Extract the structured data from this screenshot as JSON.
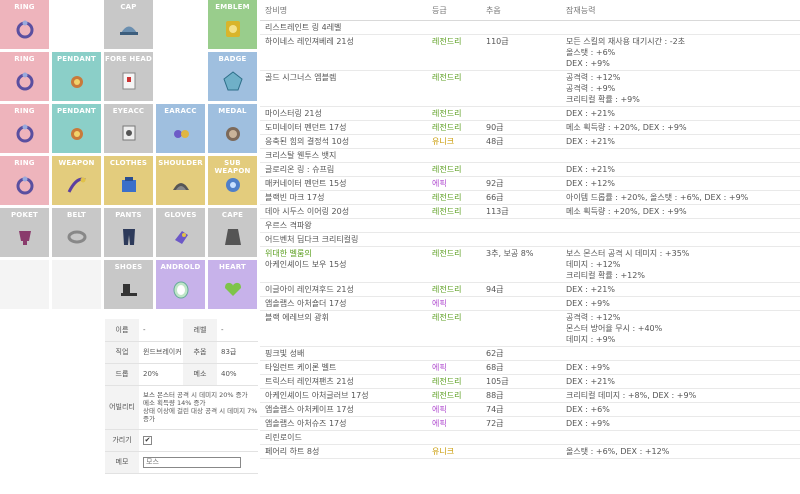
{
  "slots": [
    {
      "key": "ring1",
      "label": "RING",
      "color": "c-pink",
      "icon": "ring-icon",
      "col": 0,
      "row": 0
    },
    {
      "key": "cap",
      "label": "CAP",
      "color": "c-gray",
      "icon": "cap-icon",
      "col": 2,
      "row": 0
    },
    {
      "key": "emblem",
      "label": "EMBLEM",
      "color": "c-green",
      "icon": "emblem-icon",
      "col": 4,
      "row": 0
    },
    {
      "key": "ring2",
      "label": "RING",
      "color": "c-pink",
      "icon": "ring-icon",
      "col": 0,
      "row": 1
    },
    {
      "key": "pendant1",
      "label": "PENDANT",
      "color": "c-teal",
      "icon": "pendant-icon",
      "col": 1,
      "row": 1
    },
    {
      "key": "forehead",
      "label": "FORE HEAD",
      "color": "c-gray",
      "icon": "forehead-icon",
      "col": 2,
      "row": 1
    },
    {
      "key": "badge",
      "label": "BADGE",
      "color": "c-blue",
      "icon": "badge-icon",
      "col": 4,
      "row": 1
    },
    {
      "key": "ring3",
      "label": "RING",
      "color": "c-pink",
      "icon": "ring-icon",
      "col": 0,
      "row": 2
    },
    {
      "key": "pendant2",
      "label": "PENDANT",
      "color": "c-teal",
      "icon": "pendant-icon",
      "col": 1,
      "row": 2
    },
    {
      "key": "eyeacc",
      "label": "EYEACC",
      "color": "c-gray",
      "icon": "eye-accessory-icon",
      "col": 2,
      "row": 2
    },
    {
      "key": "earacc",
      "label": "EARACC",
      "color": "c-blue",
      "icon": "earring-icon",
      "col": 3,
      "row": 2
    },
    {
      "key": "medal",
      "label": "MEDAL",
      "color": "c-blue",
      "icon": "medal-icon",
      "col": 4,
      "row": 2
    },
    {
      "key": "ring4",
      "label": "RING",
      "color": "c-pink",
      "icon": "ring-icon",
      "col": 0,
      "row": 3
    },
    {
      "key": "weapon",
      "label": "WEAPON",
      "color": "c-yellow",
      "icon": "weapon-icon",
      "col": 1,
      "row": 3
    },
    {
      "key": "clothes",
      "label": "CLOTHES",
      "color": "c-yellow",
      "icon": "clothes-icon",
      "col": 2,
      "row": 3
    },
    {
      "key": "shoulder",
      "label": "SHOULDER",
      "color": "c-yellow",
      "icon": "shoulder-icon",
      "col": 3,
      "row": 3
    },
    {
      "key": "subweapon",
      "label": "SUB WEAPON",
      "color": "c-yellow",
      "icon": "sub-weapon-icon",
      "col": 4,
      "row": 3
    },
    {
      "key": "poket",
      "label": "POKET",
      "color": "c-gray",
      "icon": "pocket-icon",
      "col": 0,
      "row": 4
    },
    {
      "key": "belt",
      "label": "BELT",
      "color": "c-gray",
      "icon": "belt-icon",
      "col": 1,
      "row": 4
    },
    {
      "key": "pants",
      "label": "PANTS",
      "color": "c-gray",
      "icon": "pants-icon",
      "col": 2,
      "row": 4
    },
    {
      "key": "gloves",
      "label": "GLOVES",
      "color": "c-gray",
      "icon": "gloves-icon",
      "col": 3,
      "row": 4
    },
    {
      "key": "cape",
      "label": "CAPE",
      "color": "c-gray",
      "icon": "cape-icon",
      "col": 4,
      "row": 4
    },
    {
      "key": "shoes",
      "label": "SHOES",
      "color": "c-gray",
      "icon": "shoes-icon",
      "col": 2,
      "row": 5
    },
    {
      "key": "android",
      "label": "ANDROLD",
      "color": "c-purple",
      "icon": "android-icon",
      "col": 3,
      "row": 5
    },
    {
      "key": "heart",
      "label": "HEART",
      "color": "c-purple",
      "icon": "heart-icon",
      "col": 4,
      "row": 5
    }
  ],
  "info": {
    "name_label": "이름",
    "name_value": "-",
    "level_label": "레벨",
    "level_value": "-",
    "job_label": "직업",
    "job_value": "윈드브레이커",
    "star_label": "추옵",
    "star_value": "83급",
    "drop_label": "드롭",
    "drop_value": "20%",
    "meso_label": "메소",
    "meso_value": "40%",
    "ability_label": "어빌리티",
    "ability_lines": [
      "보스 몬스터 공격 시 데미지 20% 증가",
      "메소 획득량 14% 증가",
      "상태 이상에 걸린 대상 공격 시 데미지 7% 증가"
    ],
    "hide_label": "가리기",
    "hide_check": "✔",
    "memo_label": "메모",
    "memo_placeholder": "모스"
  },
  "table": {
    "headers": {
      "name": "장비명",
      "grade": "등급",
      "option": "추옵",
      "potential": "잠재능력"
    },
    "rows": [
      {
        "name": [
          "리스트레인트 링 4레벨"
        ],
        "grade": "",
        "gclass": "",
        "opt": "",
        "pot": []
      },
      {
        "name": [
          "하이네스 레인져베레 21성"
        ],
        "grade": "레전드리",
        "gclass": "g-leg",
        "opt": "110급",
        "pot": [
          "모든 스킬의 재사용 대기시간 : -2초",
          "올스탯 : +6%",
          "DEX : +9%"
        ]
      },
      {
        "name": [
          "골드 시그너스 엠블렘"
        ],
        "grade": "레전드리",
        "gclass": "g-leg",
        "opt": "",
        "pot": [
          "공격력 : +12%",
          "공격력 : +9%",
          "크리티컬 확률 : +9%"
        ]
      },
      {
        "name": [
          "마이스터링 21성"
        ],
        "grade": "레전드리",
        "gclass": "g-leg",
        "opt": "",
        "pot": [
          "DEX : +21%"
        ]
      },
      {
        "name": [
          "도미네이터 펜던트 17성"
        ],
        "grade": "레전드리",
        "gclass": "g-leg",
        "opt": "90급",
        "pot": [
          "메소 획득량 : +20%, DEX : +9%"
        ]
      },
      {
        "name": [
          "응축된 힘의 결정석 10성"
        ],
        "grade": "유니크",
        "gclass": "g-uni",
        "opt": "48급",
        "pot": [
          "DEX : +21%"
        ]
      },
      {
        "name": [
          "크리스탈 웬투스 뱃지"
        ],
        "grade": "",
        "gclass": "",
        "opt": "",
        "pot": []
      },
      {
        "name": [
          "글로리온 링 : 슈프림"
        ],
        "grade": "레전드리",
        "gclass": "g-leg",
        "opt": "",
        "pot": [
          "DEX : +21%"
        ]
      },
      {
        "name": [
          "매커네이터 펜던트 15성"
        ],
        "grade": "에픽",
        "gclass": "g-epic",
        "opt": "92급",
        "pot": [
          "DEX : +12%"
        ]
      },
      {
        "name": [
          "블랙빈 마크 17성"
        ],
        "grade": "레전드리",
        "gclass": "g-leg",
        "opt": "66급",
        "pot": [
          "아이템 드롭률 : +20%, 올스탯 : +6%, DEX : +9%"
        ]
      },
      {
        "name": [
          "데아 시두스 이어링 20성"
        ],
        "grade": "레전드리",
        "gclass": "g-leg",
        "opt": "113급",
        "pot": [
          "메소 획득량 : +20%, DEX : +9%"
        ]
      },
      {
        "name": [
          "우르스 격파왕"
        ],
        "grade": "",
        "gclass": "",
        "opt": "",
        "pot": []
      },
      {
        "name": [
          "어드벤처 딥다크 크리티컬링"
        ],
        "grade": "",
        "gclass": "",
        "opt": "",
        "pot": []
      },
      {
        "name": [
          "위대한 벨룸의",
          "아케인셰이드 보우 15성"
        ],
        "grade": "레전드리",
        "gclass": "g-leg",
        "opt": "3추, 보공 8%",
        "pot": [
          "보스 몬스터 공격 시 데미지 : +35%",
          "데미지 : +12%",
          "크리티컬 확률 : +12%"
        ]
      },
      {
        "name": [
          "이글아이 레인져후드 21성"
        ],
        "grade": "레전드리",
        "gclass": "g-leg",
        "opt": "94급",
        "pot": [
          "DEX : +21%"
        ]
      },
      {
        "name": [
          "앱솔랩스 아처숄더 17성"
        ],
        "grade": "에픽",
        "gclass": "g-epic",
        "opt": "",
        "pot": [
          "DEX : +9%"
        ]
      },
      {
        "name": [
          "블랙 에레브의 광휘"
        ],
        "grade": "레전드리",
        "gclass": "g-leg",
        "opt": "",
        "pot": [
          "공격력 : +12%",
          "몬스터 방어율 무시 : +40%",
          "데미지 : +9%"
        ]
      },
      {
        "name": [
          "핑크빛 성배"
        ],
        "grade": "",
        "gclass": "",
        "opt": "62급",
        "pot": []
      },
      {
        "name": [
          "타일런트 케이론 벨트"
        ],
        "grade": "에픽",
        "gclass": "g-epic",
        "opt": "68급",
        "pot": [
          "DEX : +9%"
        ]
      },
      {
        "name": [
          "트릭스터 레인져팬츠 21성"
        ],
        "grade": "레전드리",
        "gclass": "g-leg",
        "opt": "105급",
        "pot": [
          "DEX : +21%"
        ]
      },
      {
        "name": [
          "아케인셰이드 아처글러브 17성"
        ],
        "grade": "레전드리",
        "gclass": "g-leg",
        "opt": "88급",
        "pot": [
          "크리티컬 데미지 : +8%, DEX : +9%"
        ]
      },
      {
        "name": [
          "앱솔랩스 아처케이프 17성"
        ],
        "grade": "에픽",
        "gclass": "g-epic",
        "opt": "74급",
        "pot": [
          "DEX : +6%"
        ]
      },
      {
        "name": [
          "앱솔랩스 아처슈즈 17성"
        ],
        "grade": "에픽",
        "gclass": "g-epic",
        "opt": "72급",
        "pot": [
          "DEX : +9%"
        ]
      },
      {
        "name": [
          "리린로이드"
        ],
        "grade": "",
        "gclass": "",
        "opt": "",
        "pot": []
      },
      {
        "name": [
          "페어리 하트 8성"
        ],
        "grade": "유니크",
        "gclass": "g-uni",
        "opt": "",
        "pot": [
          "올스탯 : +6%, DEX : +12%"
        ]
      }
    ]
  }
}
